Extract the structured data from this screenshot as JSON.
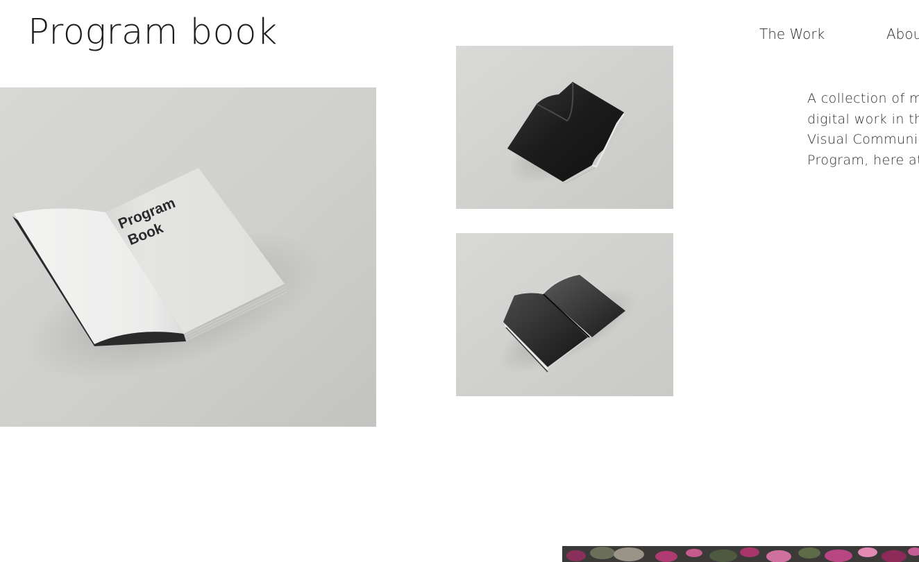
{
  "site": {
    "title": "Program book"
  },
  "nav": {
    "items": [
      {
        "label": "The Work"
      },
      {
        "label": "About"
      }
    ]
  },
  "intro": {
    "lines": [
      "A collection of my",
      "digital work in the",
      "Visual Communication",
      "Program, here at"
    ]
  },
  "gallery": {
    "main_mockup_cover_text": [
      "Program",
      "Book"
    ]
  },
  "colors": {
    "background": "#ffffff",
    "text": "#1e1e1e",
    "photo_backdrop": "#d4d5d2"
  }
}
